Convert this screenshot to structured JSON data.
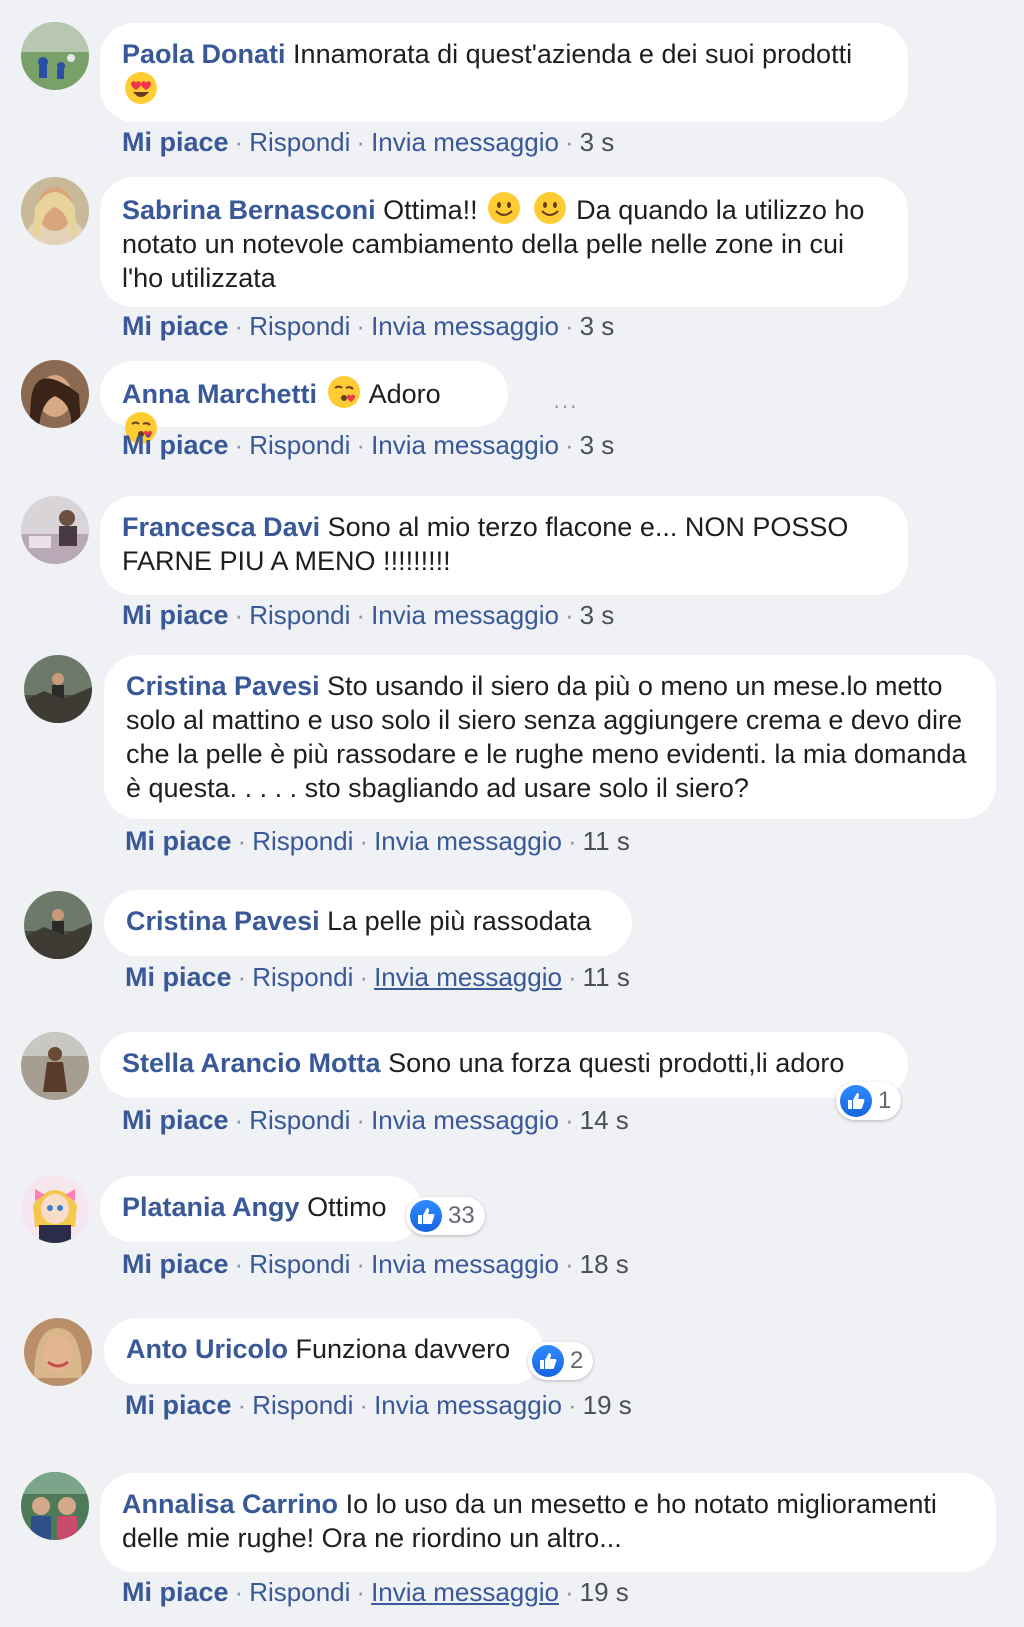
{
  "actions": {
    "like": "Mi piace",
    "reply": "Rispondi",
    "message": "Invia messaggio",
    "separator": "·"
  },
  "comments": [
    {
      "author": "Paola Donati",
      "text_before": "Innamorata di quest'azienda e dei suoi prodotti",
      "emoji": "heart-eyes-emoji",
      "time": "3 s"
    },
    {
      "author": "Sabrina Bernasconi",
      "text_before": "Ottima!!",
      "emoji": "smile-emoji",
      "text_after": "Da quando la utilizzo ho notato un notevole cambiamento della pelle nelle zone in cui l'ho utilizzata",
      "time": "3 s"
    },
    {
      "author": "Anna Marchetti",
      "text_before": "Adoro",
      "emoji": "kiss-emoji",
      "time": "3 s",
      "more": "···"
    },
    {
      "author": "Francesca Davi",
      "text_before": "Sono al mio terzo flacone e... NON POSSO FARNE PIU A MENO !!!!!!!!!",
      "time": "3 s"
    },
    {
      "author": "Cristina Pavesi",
      "text_before": "Sto usando il siero da più o meno un mese.lo metto solo al mattino e uso solo il siero senza aggiungere crema e devo dire che la pelle è più rassodare e le rughe meno evidenti. la mia domanda è questa. . . . . sto sbagliando ad usare solo il siero?",
      "time": "11 s"
    },
    {
      "author": "Cristina Pavesi",
      "text_before": "La pelle più rassodata",
      "time": "11 s"
    },
    {
      "author": "Stella Arancio Motta",
      "text_before": "Sono una forza questi prodotti,li adoro",
      "time": "14 s",
      "reactions": "1"
    },
    {
      "author": "Platania Angy",
      "text_before": "Ottimo",
      "time": "18 s",
      "reactions": "33"
    },
    {
      "author": "Anto Uricolo",
      "text_before": "Funziona davvero",
      "time": "19 s",
      "reactions": "2"
    },
    {
      "author": "Annalisa Carrino",
      "text_before": "Io lo uso da un mesetto e ho notato miglioramenti delle mie rughe! Ora ne riordino un altro...",
      "time": "19 s"
    }
  ],
  "colors": {
    "author": "#385898",
    "background": "#eff1f4",
    "bubble": "#ffffff",
    "like_badge": "#1877f2"
  }
}
